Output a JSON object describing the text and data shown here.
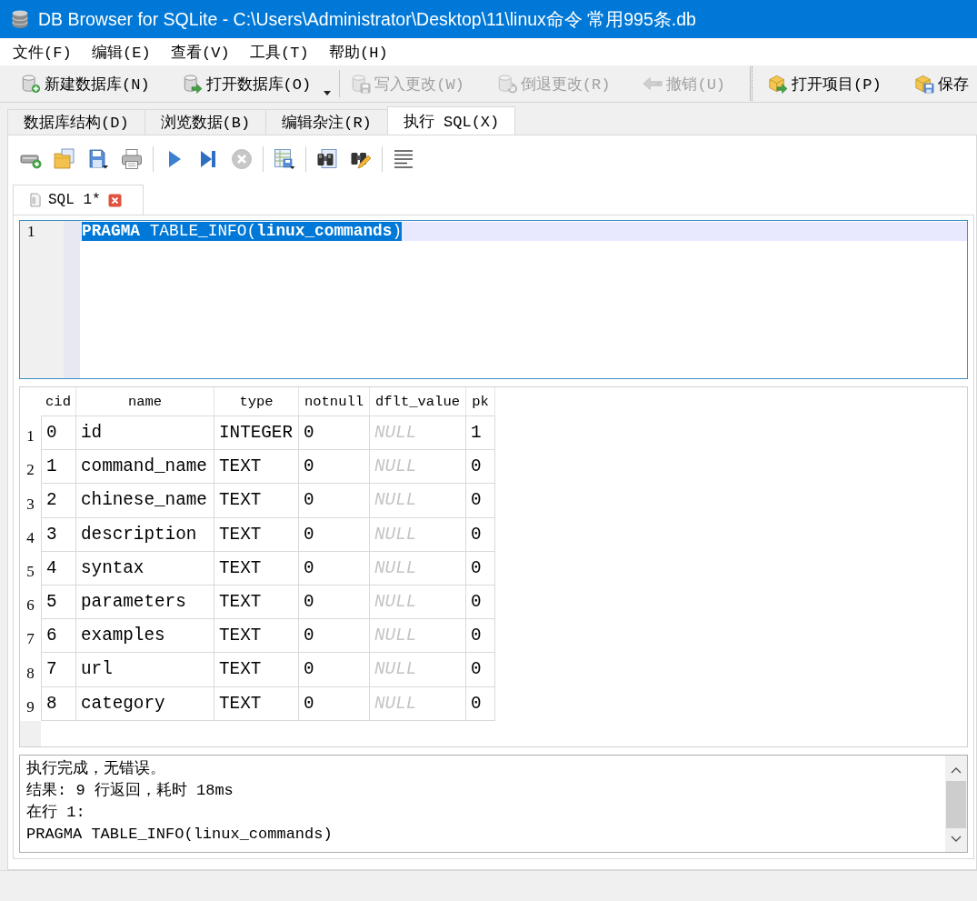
{
  "window": {
    "title": "DB Browser for SQLite - C:\\Users\\Administrator\\Desktop\\11\\linux命令 常用995条.db"
  },
  "menu": [
    "文件(F)",
    "编辑(E)",
    "查看(V)",
    "工具(T)",
    "帮助(H)"
  ],
  "toolbars": [
    {
      "groups": [
        [
          {
            "label": "新建数据库(N)",
            "disabled": false,
            "dropdown": false
          },
          {
            "label": "打开数据库(O)",
            "disabled": false,
            "dropdown": true
          }
        ],
        [
          {
            "label": "写入更改(W)",
            "disabled": true,
            "dropdown": false
          },
          {
            "label": "倒退更改(R)",
            "disabled": true,
            "dropdown": false
          },
          {
            "label": "撤销(U)",
            "disabled": true,
            "dropdown": false
          }
        ]
      ]
    },
    {
      "groups": [
        [
          {
            "label": "打开项目(P)",
            "disabled": false,
            "dropdown": false
          },
          {
            "label": "保存",
            "disabled": false,
            "dropdown": false
          }
        ]
      ]
    }
  ],
  "tabs": [
    {
      "label": "数据库结构(D)",
      "selected": false
    },
    {
      "label": "浏览数据(B)",
      "selected": false
    },
    {
      "label": "编辑杂注(R)",
      "selected": false
    },
    {
      "label": "执行 SQL(X)",
      "selected": true
    }
  ],
  "sql_toolbar": {
    "groups": [
      [
        {
          "disabled": false
        },
        {
          "disabled": false
        },
        {
          "disabled": false
        },
        {
          "disabled": false
        }
      ],
      [
        {
          "disabled": false
        },
        {
          "disabled": false
        },
        {
          "disabled": true
        }
      ],
      [
        {
          "disabled": false
        }
      ],
      [
        {
          "disabled": false
        },
        {
          "disabled": false
        }
      ],
      [
        {
          "disabled": false
        }
      ]
    ]
  },
  "editor_tabs": [
    {
      "label": "SQL 1*",
      "selected": true
    }
  ],
  "editor": {
    "lines": [
      {
        "number": "1",
        "text": "**PRAGMA** TABLE_INFO(**linux_commands**)",
        "current": true,
        "selected": true
      }
    ]
  },
  "results": {
    "columns": [
      "cid",
      "name",
      "type",
      "notnull",
      "dflt_value",
      "pk"
    ],
    "rows": [
      {
        "number": "1",
        "cells": [
          {
            "text": "0",
            "null": false
          },
          {
            "text": "id",
            "null": false
          },
          {
            "text": "INTEGER",
            "null": false
          },
          {
            "text": "0",
            "null": false
          },
          {
            "text": "NULL",
            "null": true
          },
          {
            "text": "1",
            "null": false
          }
        ]
      },
      {
        "number": "2",
        "cells": [
          {
            "text": "1",
            "null": false
          },
          {
            "text": "command_name",
            "null": false
          },
          {
            "text": "TEXT",
            "null": false
          },
          {
            "text": "0",
            "null": false
          },
          {
            "text": "NULL",
            "null": true
          },
          {
            "text": "0",
            "null": false
          }
        ]
      },
      {
        "number": "3",
        "cells": [
          {
            "text": "2",
            "null": false
          },
          {
            "text": "chinese_name",
            "null": false
          },
          {
            "text": "TEXT",
            "null": false
          },
          {
            "text": "0",
            "null": false
          },
          {
            "text": "NULL",
            "null": true
          },
          {
            "text": "0",
            "null": false
          }
        ]
      },
      {
        "number": "4",
        "cells": [
          {
            "text": "3",
            "null": false
          },
          {
            "text": "description",
            "null": false
          },
          {
            "text": "TEXT",
            "null": false
          },
          {
            "text": "0",
            "null": false
          },
          {
            "text": "NULL",
            "null": true
          },
          {
            "text": "0",
            "null": false
          }
        ]
      },
      {
        "number": "5",
        "cells": [
          {
            "text": "4",
            "null": false
          },
          {
            "text": "syntax",
            "null": false
          },
          {
            "text": "TEXT",
            "null": false
          },
          {
            "text": "0",
            "null": false
          },
          {
            "text": "NULL",
            "null": true
          },
          {
            "text": "0",
            "null": false
          }
        ]
      },
      {
        "number": "6",
        "cells": [
          {
            "text": "5",
            "null": false
          },
          {
            "text": "parameters",
            "null": false
          },
          {
            "text": "TEXT",
            "null": false
          },
          {
            "text": "0",
            "null": false
          },
          {
            "text": "NULL",
            "null": true
          },
          {
            "text": "0",
            "null": false
          }
        ]
      },
      {
        "number": "7",
        "cells": [
          {
            "text": "6",
            "null": false
          },
          {
            "text": "examples",
            "null": false
          },
          {
            "text": "TEXT",
            "null": false
          },
          {
            "text": "0",
            "null": false
          },
          {
            "text": "NULL",
            "null": true
          },
          {
            "text": "0",
            "null": false
          }
        ]
      },
      {
        "number": "8",
        "cells": [
          {
            "text": "7",
            "null": false
          },
          {
            "text": "url",
            "null": false
          },
          {
            "text": "TEXT",
            "null": false
          },
          {
            "text": "0",
            "null": false
          },
          {
            "text": "NULL",
            "null": true
          },
          {
            "text": "0",
            "null": false
          }
        ]
      },
      {
        "number": "9",
        "cells": [
          {
            "text": "8",
            "null": false
          },
          {
            "text": "category",
            "null": false
          },
          {
            "text": "TEXT",
            "null": false
          },
          {
            "text": "0",
            "null": false
          },
          {
            "text": "NULL",
            "null": true
          },
          {
            "text": "0",
            "null": false
          }
        ]
      }
    ]
  },
  "messages": {
    "lines": [
      "执行完成，无错误。",
      "结果: 9 行返回，耗时 18ms",
      "在行 1:",
      "PRAGMA TABLE_INFO(linux_commands)"
    ]
  }
}
